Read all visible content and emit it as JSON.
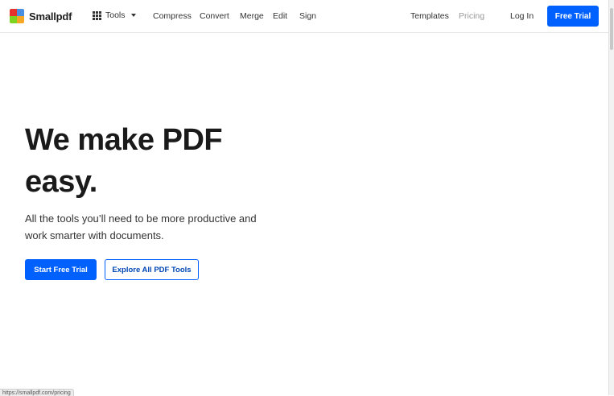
{
  "brand": {
    "name": "Smallpdf",
    "logo_colors": [
      "#e5322d",
      "#4a90e2",
      "#7ed321",
      "#f5a623"
    ]
  },
  "nav": {
    "tools_label": "Tools",
    "links": [
      "Compress",
      "Convert",
      "Merge",
      "Edit",
      "Sign"
    ],
    "templates_label": "Templates",
    "pricing_label": "Pricing",
    "login_label": "Log In",
    "free_trial_label": "Free Trial"
  },
  "hero": {
    "title_line1": "We make PDF",
    "title_line2": "easy.",
    "subtitle": "All the tools you’ll need to be more productive and work smarter with documents.",
    "primary_cta": "Start Free Trial",
    "secondary_cta": "Explore All PDF Tools"
  },
  "status_bar": {
    "url": "https://smallpdf.com/pricing"
  },
  "colors": {
    "accent": "#0061fe",
    "text": "#1a1a1a",
    "muted": "#9a9a9a"
  }
}
